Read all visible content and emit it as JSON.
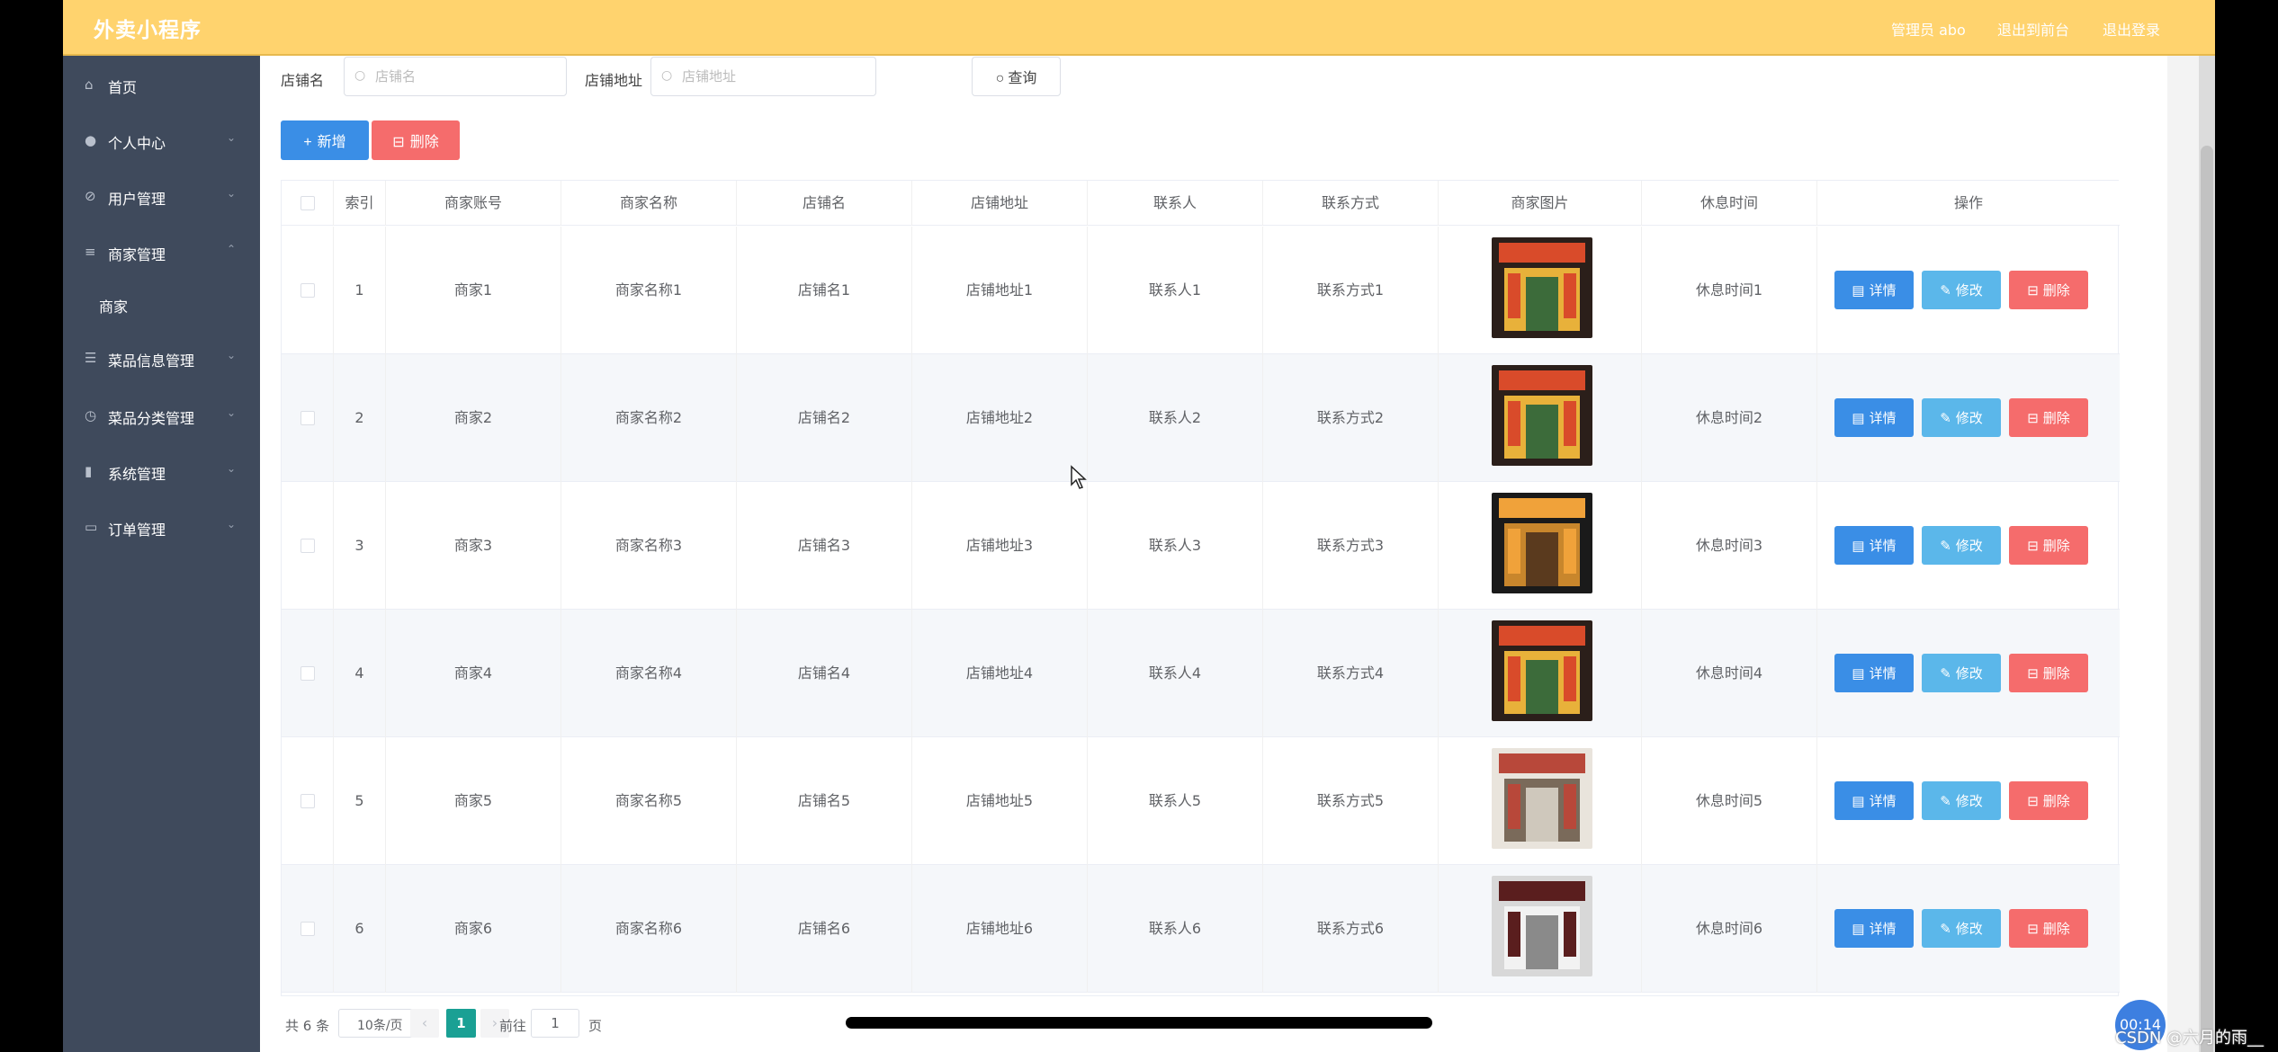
{
  "header": {
    "app_title": "外卖小程序",
    "admin_label": "管理员 abo",
    "back_to_front": "退出到前台",
    "logout": "退出登录"
  },
  "sidebar": {
    "items": [
      {
        "label": "首页",
        "icon": "home-icon",
        "expandable": false
      },
      {
        "label": "个人中心",
        "icon": "user-icon",
        "expandable": true
      },
      {
        "label": "用户管理",
        "icon": "bell-off-icon",
        "expandable": true
      },
      {
        "label": "商家管理",
        "icon": "list-icon",
        "expandable": true,
        "expanded": true
      },
      {
        "label": "菜品信息管理",
        "icon": "sliders-icon",
        "expandable": true
      },
      {
        "label": "菜品分类管理",
        "icon": "gauge-icon",
        "expandable": true
      },
      {
        "label": "系统管理",
        "icon": "bar-chart-icon",
        "expandable": true
      },
      {
        "label": "订单管理",
        "icon": "message-icon",
        "expandable": true
      }
    ],
    "sub_items": [
      {
        "label": "商家"
      }
    ]
  },
  "filters": {
    "shop_name_label": "店铺名",
    "shop_name_placeholder": "店铺名",
    "shop_address_label": "店铺地址",
    "shop_address_placeholder": "店铺地址",
    "query_label": "查询"
  },
  "toolbar": {
    "add_label": "新增",
    "delete_label": "删除"
  },
  "table": {
    "columns": [
      "索引",
      "商家账号",
      "商家名称",
      "店铺名",
      "店铺地址",
      "联系人",
      "联系方式",
      "商家图片",
      "休息时间",
      "操作"
    ],
    "rows": [
      {
        "index": "1",
        "account": "商家1",
        "name": "商家名称1",
        "shop": "店铺名1",
        "address": "店铺地址1",
        "contact": "联系人1",
        "phone": "联系方式1",
        "rest": "休息时间1"
      },
      {
        "index": "2",
        "account": "商家2",
        "name": "商家名称2",
        "shop": "店铺名2",
        "address": "店铺地址2",
        "contact": "联系人2",
        "phone": "联系方式2",
        "rest": "休息时间2"
      },
      {
        "index": "3",
        "account": "商家3",
        "name": "商家名称3",
        "shop": "店铺名3",
        "address": "店铺地址3",
        "contact": "联系人3",
        "phone": "联系方式3",
        "rest": "休息时间3"
      },
      {
        "index": "4",
        "account": "商家4",
        "name": "商家名称4",
        "shop": "店铺名4",
        "address": "店铺地址4",
        "contact": "联系人4",
        "phone": "联系方式4",
        "rest": "休息时间4"
      },
      {
        "index": "5",
        "account": "商家5",
        "name": "商家名称5",
        "shop": "店铺名5",
        "address": "店铺地址5",
        "contact": "联系人5",
        "phone": "联系方式5",
        "rest": "休息时间5"
      },
      {
        "index": "6",
        "account": "商家6",
        "name": "商家名称6",
        "shop": "店铺名6",
        "address": "店铺地址6",
        "contact": "联系人6",
        "phone": "联系方式6",
        "rest": "休息时间6"
      }
    ],
    "actions": {
      "detail": "详情",
      "edit": "修改",
      "delete": "删除"
    }
  },
  "pagination": {
    "total_text": "共 6 条",
    "page_size": "10条/页",
    "current_page": "1",
    "goto_prefix": "前往",
    "goto_value": "1",
    "goto_suffix": "页"
  },
  "overlay": {
    "timer": "00:14",
    "watermark": "CSDN @六月的雨__"
  },
  "colors": {
    "header": "#ffd36e",
    "sidebar": "#3f4a5c",
    "primary": "#3a8ee6",
    "info": "#5bb7ea",
    "danger": "#f56c6c",
    "pager_active": "#1aa094"
  }
}
